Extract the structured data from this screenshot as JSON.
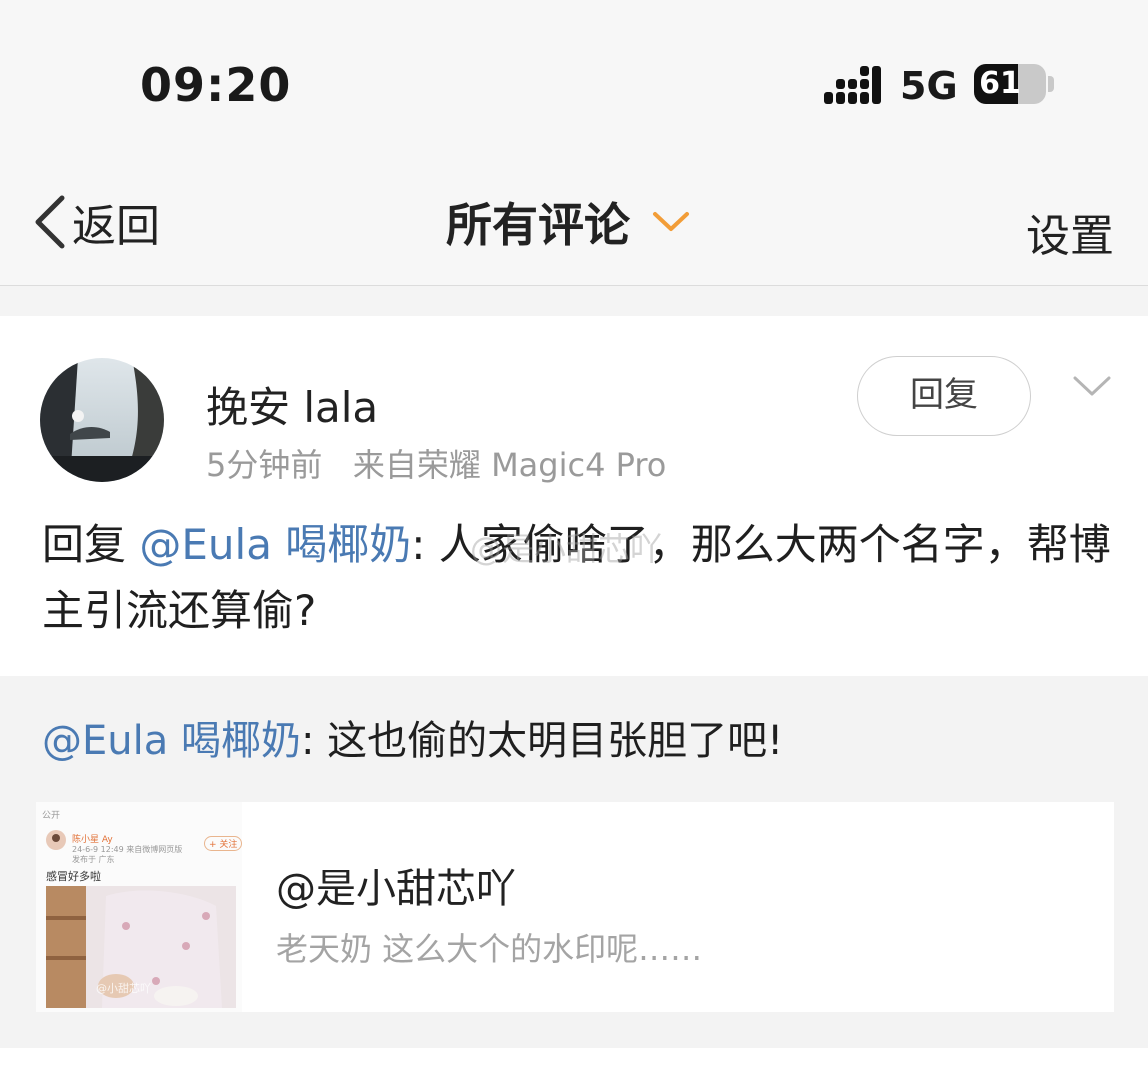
{
  "status_bar": {
    "time": "09:20",
    "network": "5G",
    "battery_level": 61,
    "battery_label": "61"
  },
  "nav": {
    "back_label": "返回",
    "title": "所有评论",
    "settings_label": "设置",
    "accent_color": "#f29d38"
  },
  "comment": {
    "username": "挽安 lala",
    "time_ago": "5分钟前",
    "source": "来自荣耀 Magic4 Pro",
    "reply_button": "回复",
    "reply_prefix": "回复",
    "mention": "@Eula 喝椰奶",
    "body": ": 人家偷啥了，那么大两个名字，帮博主引流还算偷?",
    "image_watermark": "@是小甜芯吖"
  },
  "quoted": {
    "mention": "@Eula 喝椰奶",
    "text": ": 这也偷的太明目张胆了吧!",
    "post": {
      "author": "@是小甜芯吖",
      "description": "老天奶 这么大个的水印呢……",
      "thumb_visibility": "公开",
      "thumb_author": "陈小星 Ay",
      "thumb_follow": "+ 关注",
      "thumb_date": "24-6-9 12:49 来自微博网页版",
      "thumb_location": "发布于 广东",
      "thumb_text": "感冒好多啦",
      "thumb_overlay": "@小甜芯吖"
    }
  },
  "colors": {
    "mention": "#4a7ab3",
    "meta_gray": "#9a9a9a"
  }
}
